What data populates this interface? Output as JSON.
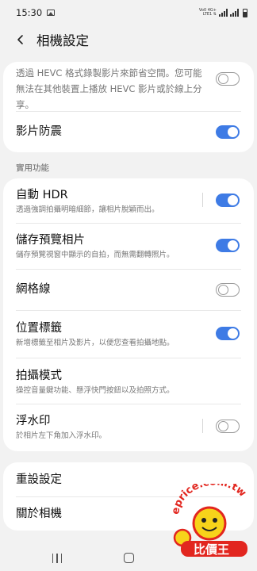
{
  "status": {
    "time": "15:30",
    "network_line1": "Vo0 4G+",
    "network_line2": "LTE1 ⇅"
  },
  "header": {
    "title": "相機設定",
    "back_icon": "back-arrow-icon"
  },
  "top_card": {
    "hevc_description": "透過 HEVC 格式錄製影片來節省空間。您可能無法在其他裝置上播放 HEVC 影片或於線上分享。",
    "hevc_toggle": false,
    "stabilization_label": "影片防震",
    "stabilization_toggle": true
  },
  "section_label": "實用功能",
  "features": [
    {
      "title": "自動 HDR",
      "subtitle": "透過強調拍攝明暗細節，讓相片脫穎而出。",
      "on": true
    },
    {
      "title": "儲存預覽相片",
      "subtitle": "儲存預覽視窗中顯示的自拍，而無需翻轉照片。",
      "on": true
    },
    {
      "title": "網格線",
      "subtitle": "",
      "on": false
    },
    {
      "title": "位置標籤",
      "subtitle": "新增標籤至相片及影片，以便您查看拍攝地點。",
      "on": true
    },
    {
      "title": "拍攝模式",
      "subtitle": "操控音量鍵功能、懸浮快門按鈕以及拍照方式。",
      "on": null
    },
    {
      "title": "浮水印",
      "subtitle": "於相片左下角加入浮水印。",
      "on": false
    }
  ],
  "bottom_card": {
    "reset_label": "重設設定",
    "about_label": "關於相機"
  },
  "watermark": {
    "url_text": "eprice.com.tw",
    "logo_text": "比價王"
  },
  "colors": {
    "accent": "#3e7be5",
    "background": "#f2f2f2",
    "card": "#ffffff"
  }
}
